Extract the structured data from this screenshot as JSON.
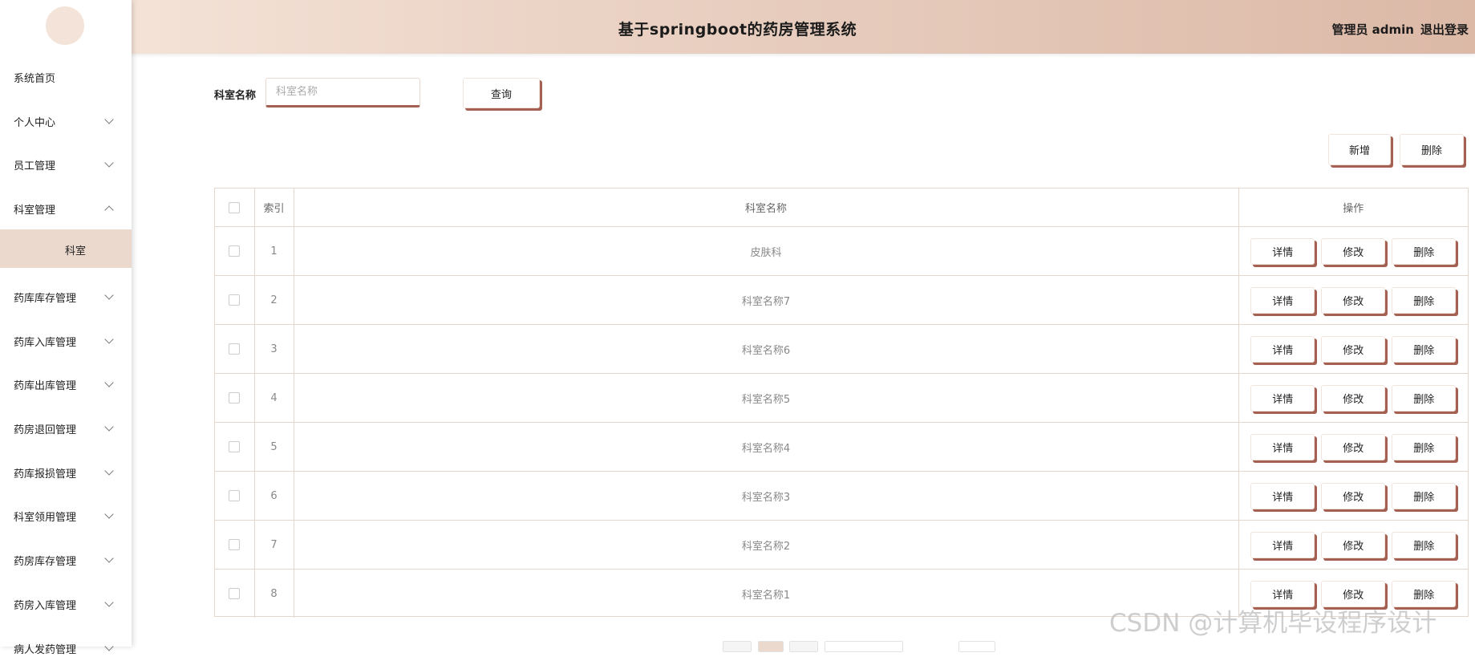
{
  "header": {
    "title": "基于springboot的药房管理系统",
    "role_user": "管理员 admin",
    "logout": "退出登录"
  },
  "sidebar": {
    "items": [
      {
        "label": "系统首页",
        "expandable": false
      },
      {
        "label": "个人中心",
        "expandable": true
      },
      {
        "label": "员工管理",
        "expandable": true
      },
      {
        "label": "科室管理",
        "expandable": true,
        "expanded": true
      },
      {
        "label": "药库库存管理",
        "expandable": true
      },
      {
        "label": "药库入库管理",
        "expandable": true
      },
      {
        "label": "药库出库管理",
        "expandable": true
      },
      {
        "label": "药房退回管理",
        "expandable": true
      },
      {
        "label": "药库报损管理",
        "expandable": true
      },
      {
        "label": "科室领用管理",
        "expandable": true
      },
      {
        "label": "药房库存管理",
        "expandable": true
      },
      {
        "label": "药房入库管理",
        "expandable": true
      },
      {
        "label": "病人发药管理",
        "expandable": true
      }
    ],
    "active_sub": "科室"
  },
  "search": {
    "label": "科室名称",
    "placeholder": "科室名称",
    "value": "",
    "query_button": "查询"
  },
  "toolbar": {
    "add_button": "新增",
    "delete_button": "删除"
  },
  "table": {
    "columns": [
      "",
      "索引",
      "科室名称",
      "操作"
    ],
    "rows": [
      {
        "index": "1",
        "name": "皮肤科"
      },
      {
        "index": "2",
        "name": "科室名称7"
      },
      {
        "index": "3",
        "name": "科室名称6"
      },
      {
        "index": "4",
        "name": "科室名称5"
      },
      {
        "index": "5",
        "name": "科室名称4"
      },
      {
        "index": "6",
        "name": "科室名称3"
      },
      {
        "index": "7",
        "name": "科室名称2"
      },
      {
        "index": "8",
        "name": "科室名称1"
      }
    ],
    "row_actions": [
      "详情",
      "修改",
      "删除"
    ]
  },
  "watermark": "CSDN @计算机毕设程序设计",
  "colors": {
    "accent_shadow": "#a46052",
    "header_start": "#f7e7dc",
    "header_end": "#dcb9a7",
    "active_sub_bg": "#ecd9cd",
    "table_border": "#e3d6cc"
  },
  "icons": [
    "chevron-down-icon",
    "chevron-up-icon",
    "avatar",
    "checkbox"
  ]
}
